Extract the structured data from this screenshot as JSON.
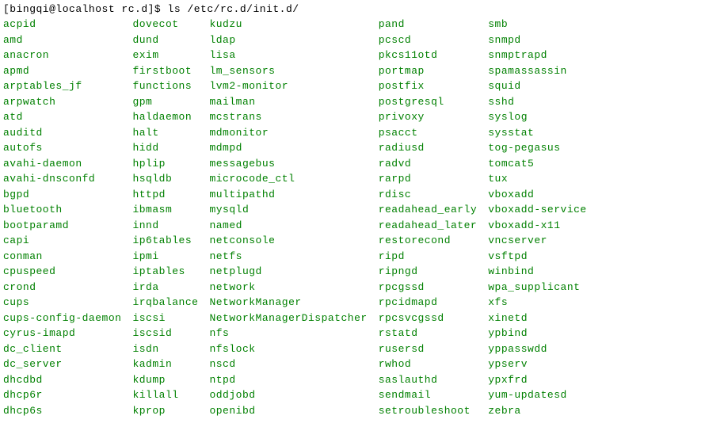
{
  "prompt": {
    "user_host": "[bingqi@localhost rc.d]$ ",
    "command": "ls /etc/rc.d/init.d/"
  },
  "columns": [
    [
      "acpid",
      "amd",
      "anacron",
      "apmd",
      "arptables_jf",
      "arpwatch",
      "atd",
      "auditd",
      "autofs",
      "avahi-daemon",
      "avahi-dnsconfd",
      "bgpd",
      "bluetooth",
      "bootparamd",
      "capi",
      "conman",
      "cpuspeed",
      "crond",
      "cups",
      "cups-config-daemon",
      "cyrus-imapd",
      "dc_client",
      "dc_server",
      "dhcdbd",
      "dhcp6r",
      "dhcp6s"
    ],
    [
      "dovecot",
      "dund",
      "exim",
      "firstboot",
      "functions",
      "gpm",
      "haldaemon",
      "halt",
      "hidd",
      "hplip",
      "hsqldb",
      "httpd",
      "ibmasm",
      "innd",
      "ip6tables",
      "ipmi",
      "iptables",
      "irda",
      "irqbalance",
      "iscsi",
      "iscsid",
      "isdn",
      "kadmin",
      "kdump",
      "killall",
      "kprop"
    ],
    [
      "kudzu",
      "ldap",
      "lisa",
      "lm_sensors",
      "lvm2-monitor",
      "mailman",
      "mcstrans",
      "mdmonitor",
      "mdmpd",
      "messagebus",
      "microcode_ctl",
      "multipathd",
      "mysqld",
      "named",
      "netconsole",
      "netfs",
      "netplugd",
      "network",
      "NetworkManager",
      "NetworkManagerDispatcher",
      "nfs",
      "nfslock",
      "nscd",
      "ntpd",
      "oddjobd",
      "openibd"
    ],
    [
      "pand",
      "pcscd",
      "pkcs11otd",
      "portmap",
      "postfix",
      "postgresql",
      "privoxy",
      "psacct",
      "radiusd",
      "radvd",
      "rarpd",
      "rdisc",
      "readahead_early",
      "readahead_later",
      "restorecond",
      "ripd",
      "ripngd",
      "rpcgssd",
      "rpcidmapd",
      "rpcsvcgssd",
      "rstatd",
      "rusersd",
      "rwhod",
      "saslauthd",
      "sendmail",
      "setroubleshoot"
    ],
    [
      "smb",
      "snmpd",
      "snmptrapd",
      "spamassassin",
      "squid",
      "sshd",
      "syslog",
      "sysstat",
      "tog-pegasus",
      "tomcat5",
      "tux",
      "vboxadd",
      "vboxadd-service",
      "vboxadd-x11",
      "vncserver",
      "vsftpd",
      "winbind",
      "wpa_supplicant",
      "xfs",
      "xinetd",
      "ypbind",
      "yppasswdd",
      "ypserv",
      "ypxfrd",
      "yum-updatesd",
      "zebra"
    ]
  ]
}
